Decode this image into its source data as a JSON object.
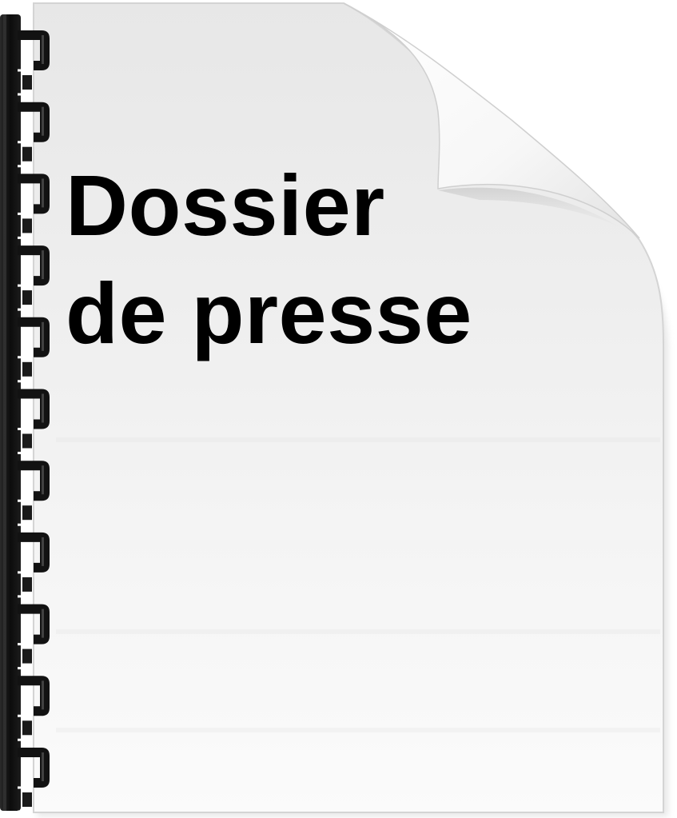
{
  "document": {
    "title_lines": [
      "Dossier",
      "de presse"
    ]
  },
  "icons": {
    "document": "document-icon",
    "binding": "spiral-binding-icon",
    "page_curl": "page-curl-icon"
  },
  "colors": {
    "paper": "#f6f6f6",
    "binding": "#111111",
    "text": "#000000"
  }
}
